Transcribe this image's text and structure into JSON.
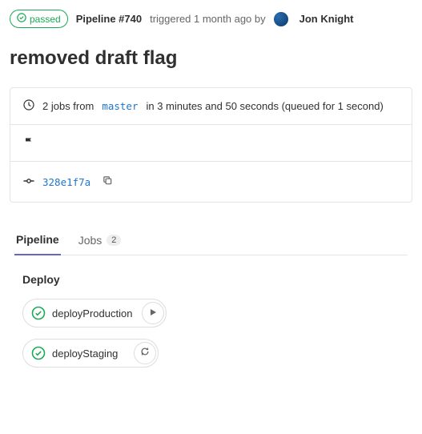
{
  "status": {
    "label": "passed"
  },
  "summary": {
    "pipeline_label": "Pipeline #740",
    "triggered_text": "triggered 1 month ago by",
    "username": "Jon Knight"
  },
  "commit_message": "removed draft flag",
  "info": {
    "jobs_prefix": "2 jobs from",
    "branch": "master",
    "duration_text": "in 3 minutes and 50 seconds (queued for 1 second)",
    "commit_sha": "328e1f7a"
  },
  "tabs": {
    "pipeline": "Pipeline",
    "jobs": "Jobs",
    "jobs_count": "2"
  },
  "stage": {
    "name": "Deploy",
    "jobs": {
      "deploy_production": "deployProduction",
      "deploy_staging": "deployStaging"
    }
  }
}
